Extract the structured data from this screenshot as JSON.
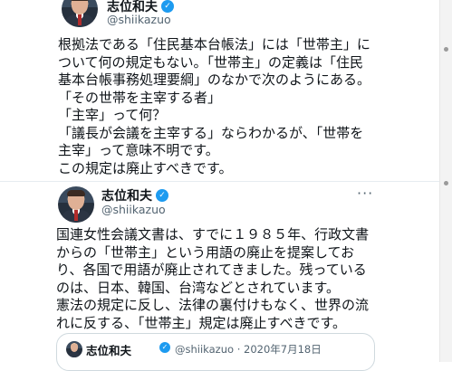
{
  "tweets": [
    {
      "author": "志位和夫",
      "handle": "@shiikazuo",
      "lines": [
        "根拠法である「住民基本台帳法」には「世帯主」に",
        "ついて何の規定もない。「世帯主」の定義は「住民",
        "基本台帳事務処理要綱」のなかで次のようにある。",
        "「その世帯を主宰する者」",
        "「主宰」って何？",
        "「議長が会議を主宰する」ならわかるが、「世帯を",
        "主宰」って意味不明です。",
        "この規定は廃止すべきです。"
      ]
    },
    {
      "author": "志位和夫",
      "handle": "@shiikazuo",
      "lines": [
        "国連女性会議文書は、すでに１９８５年、行政文書",
        "からの「世帯主」という用語の廃止を提案してお",
        "り、各国で用語が廃止されてきました。残っている",
        "のは、日本、韓国、台湾などとされています。",
        "憲法の規定に反し、法律の裏付けもなく、世界の流",
        "れに反する、「世帯主」規定は廃止すべきです。"
      ],
      "quoted": {
        "author": "志位和夫",
        "meta": "@shiikazuo · 2020年7月18日"
      }
    }
  ],
  "icons": {
    "verified": "verified-badge-icon",
    "more": "more-options-icon"
  },
  "colors": {
    "accent": "#1d9bf0",
    "text": "#0f1419",
    "secondary": "#536471"
  }
}
